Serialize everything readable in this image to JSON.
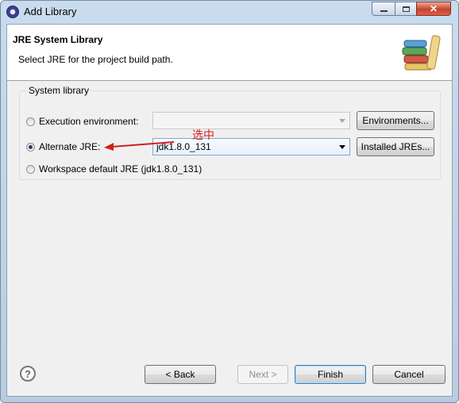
{
  "window": {
    "title": "Add Library"
  },
  "header": {
    "title": "JRE System Library",
    "description": "Select JRE for the project build path."
  },
  "group": {
    "label": "System library",
    "options": [
      {
        "label": "Execution environment:",
        "selected": false,
        "combo_value": "",
        "button": "Environments...",
        "combo_enabled": false
      },
      {
        "label": "Alternate JRE:",
        "selected": true,
        "combo_value": "jdk1.8.0_131",
        "button": "Installed JREs...",
        "combo_enabled": true
      },
      {
        "label": "Workspace default JRE (jdk1.8.0_131)",
        "selected": false
      }
    ]
  },
  "annotation": {
    "text": "选中",
    "color": "#d21f1f"
  },
  "footer": {
    "help_symbol": "?",
    "back_label": "< Back",
    "next_label": "Next >",
    "finish_label": "Finish",
    "cancel_label": "Cancel"
  }
}
